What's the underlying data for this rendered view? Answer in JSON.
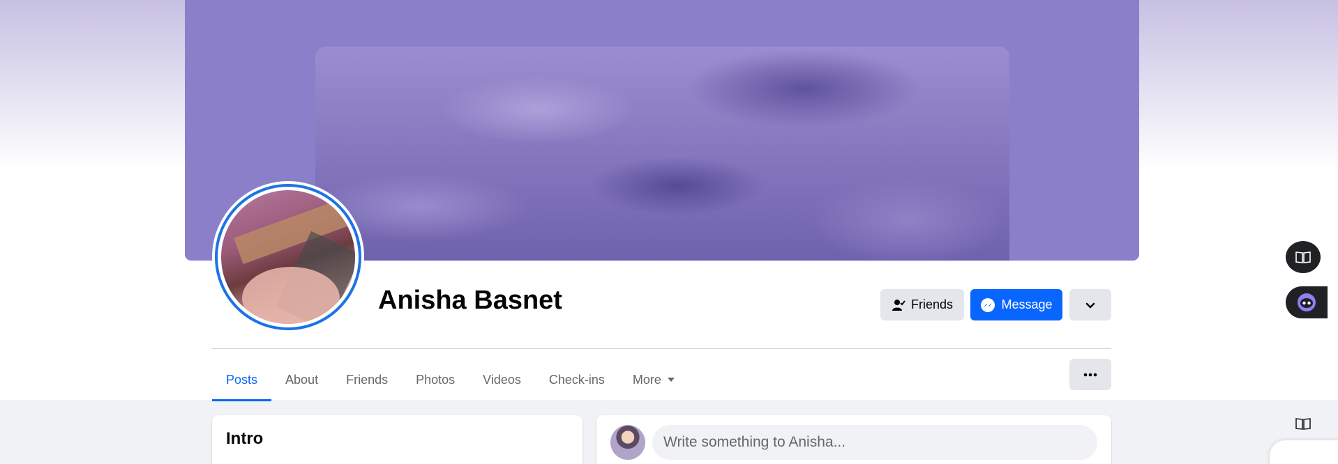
{
  "profile": {
    "name": "Anisha Basnet"
  },
  "actions": {
    "friends_label": "Friends",
    "message_label": "Message"
  },
  "tabs": [
    {
      "label": "Posts",
      "active": true
    },
    {
      "label": "About",
      "active": false
    },
    {
      "label": "Friends",
      "active": false
    },
    {
      "label": "Photos",
      "active": false
    },
    {
      "label": "Videos",
      "active": false
    },
    {
      "label": "Check-ins",
      "active": false
    },
    {
      "label": "More",
      "active": false
    }
  ],
  "intro": {
    "title": "Intro"
  },
  "composer": {
    "placeholder": "Write something to Anisha..."
  },
  "icons": {
    "friends": "person-check-icon",
    "message": "messenger-icon",
    "dropdown": "chevron-down-icon",
    "tab_more": "caret-down-icon",
    "tab_options": "more-horizontal-icon",
    "reader": "book-open-icon",
    "assistant": "ai-bot-icon"
  },
  "colors": {
    "accent": "#0866ff",
    "cover": "#8b7fca",
    "avatar_ring": "#1b74e4"
  }
}
